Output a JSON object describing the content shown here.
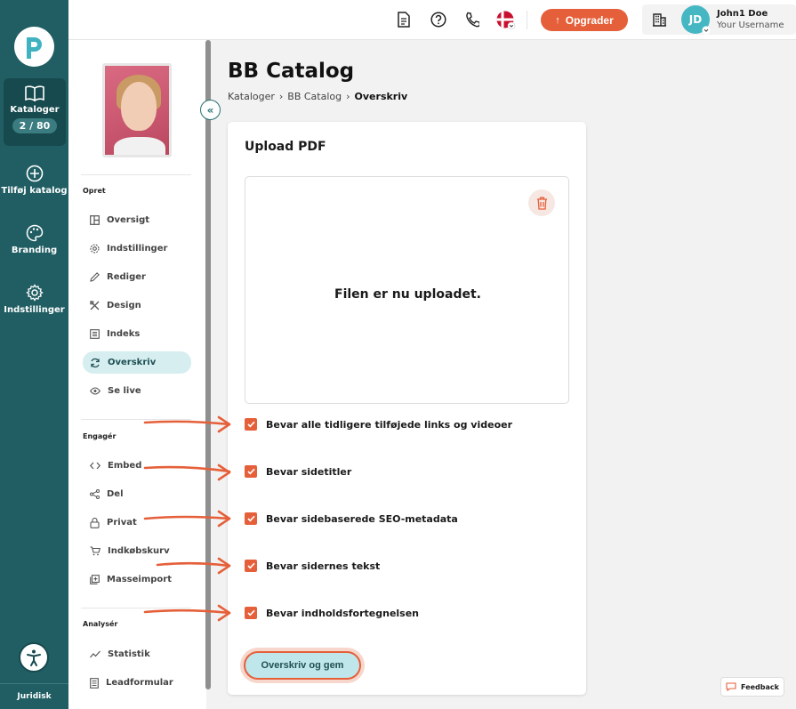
{
  "rail": {
    "items": [
      {
        "label": "Kataloger",
        "badge": "2 / 80"
      },
      {
        "label": "Tilføj katalog"
      },
      {
        "label": "Branding"
      },
      {
        "label": "Indstillinger"
      }
    ],
    "footer": "Juridisk"
  },
  "header": {
    "upgrade_label": "Opgrader",
    "user": {
      "initials": "JD",
      "name": "John1 Doe",
      "username": "Your Username"
    }
  },
  "subnav": {
    "sections": [
      {
        "label": "Opret",
        "items": [
          "Oversigt",
          "Indstillinger",
          "Rediger",
          "Design",
          "Indeks",
          "Overskriv",
          "Se live"
        ]
      },
      {
        "label": "Engagér",
        "items": [
          "Embed",
          "Del",
          "Privat",
          "Indkøbskurv",
          "Masseimport"
        ]
      },
      {
        "label": "Analysér",
        "items": [
          "Statistik",
          "Leadformular"
        ]
      }
    ],
    "active_item": "Overskriv"
  },
  "main": {
    "title": "BB Catalog",
    "breadcrumb": [
      "Kataloger",
      "BB Catalog",
      "Overskriv"
    ],
    "card": {
      "title": "Upload PDF",
      "upload_status": "Filen er nu uploadet.",
      "options": [
        {
          "label": "Bevar alle tidligere tilføjede links og videoer",
          "checked": true
        },
        {
          "label": "Bevar sidetitler",
          "checked": true
        },
        {
          "label": "Bevar sidebaserede SEO-metadata",
          "checked": true
        },
        {
          "label": "Bevar sidernes tekst",
          "checked": true
        },
        {
          "label": "Bevar indholdsfortegnelsen",
          "checked": true
        }
      ],
      "submit_label": "Overskriv og gem"
    }
  },
  "feedback_label": "Feedback",
  "colors": {
    "rail": "#215e63",
    "accent": "#e5603a",
    "active_nav": "#d6eef0",
    "avatar": "#45b7c3"
  }
}
